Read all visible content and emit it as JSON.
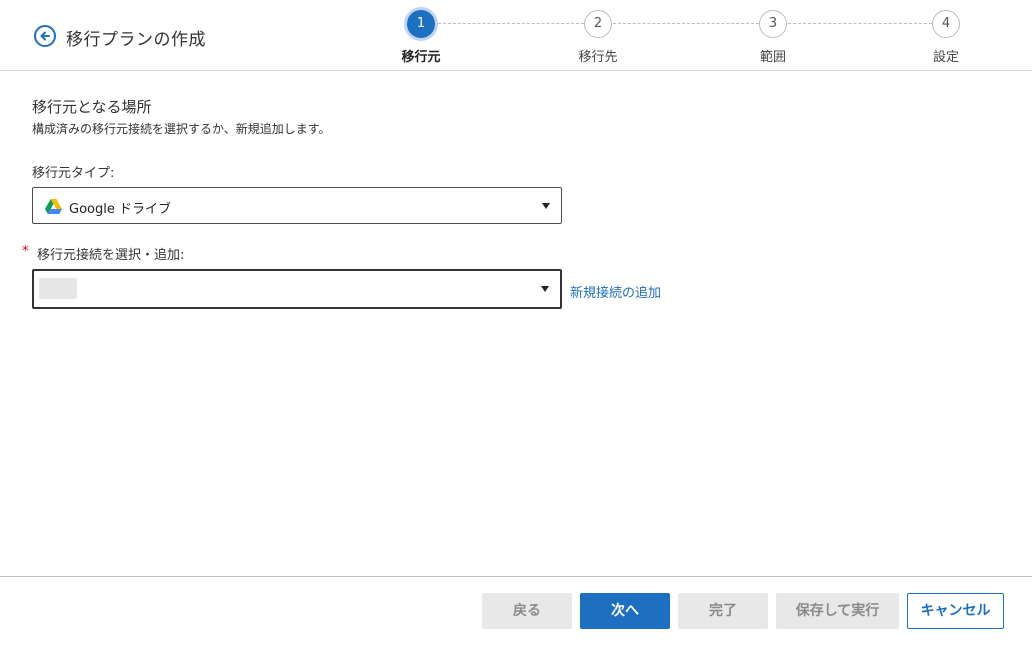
{
  "header": {
    "title": "移行プランの作成"
  },
  "stepper": {
    "steps": [
      {
        "number": "1",
        "label": "移行元"
      },
      {
        "number": "2",
        "label": "移行先"
      },
      {
        "number": "3",
        "label": "範囲"
      },
      {
        "number": "4",
        "label": "設定"
      }
    ],
    "active_step": 1
  },
  "section": {
    "title": "移行元となる場所",
    "description": "構成済みの移行元接続を選択するか、新規追加します。"
  },
  "source_type": {
    "label": "移行元タイプ:",
    "value": "Google ドライブ"
  },
  "connection": {
    "required_mark": "*",
    "label": "移行元接続を選択・追加:",
    "value": "",
    "add_link": "新規接続の追加"
  },
  "footer": {
    "back": "戻る",
    "next": "次へ",
    "finish": "完了",
    "save_run": "保存して実行",
    "cancel": "キャンセル"
  },
  "colors": {
    "accent": "#1d6fbf",
    "required": "#d0021b",
    "disabled_bg": "#e8e8e8"
  },
  "icons": {
    "back": "arrow-left-circle-icon",
    "source_type": "google-drive-icon",
    "dropdown": "caret-down-icon"
  }
}
